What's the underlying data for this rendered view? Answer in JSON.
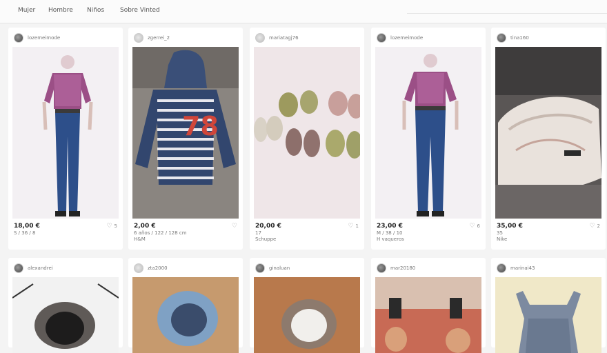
{
  "nav": {
    "items": [
      "Mujer",
      "Hombre",
      "Niños",
      "Sobre Vinted"
    ]
  },
  "listings": [
    {
      "user": "lozemeimode",
      "price": "18,00 €",
      "size": "S / 36 / 8",
      "brand": "",
      "likes": "5"
    },
    {
      "user": "zgerrei_2",
      "price": "2,00 €",
      "size": "6 años / 122 / 128 cm",
      "brand": "H&M",
      "likes": ""
    },
    {
      "user": "mariatagj76",
      "price": "20,00 €",
      "size": "17",
      "brand": "Schuppe",
      "likes": "1"
    },
    {
      "user": "lozemeimode",
      "price": "23,00 €",
      "size": "M / 38 / 10",
      "brand": "H vaqueros",
      "likes": "6"
    },
    {
      "user": "tina160",
      "price": "35,00 €",
      "size": "35",
      "brand": "Nike",
      "likes": "2"
    }
  ],
  "listings_row2": [
    {
      "user": "alexandrei"
    },
    {
      "user": "zta2000"
    },
    {
      "user": "ginaluan"
    },
    {
      "user": "mar20180"
    },
    {
      "user": "marinai43"
    }
  ]
}
